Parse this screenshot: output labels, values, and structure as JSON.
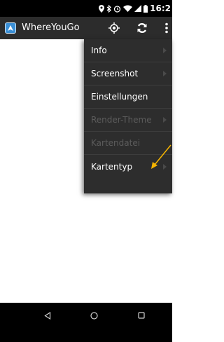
{
  "status_bar": {
    "time": "16:2",
    "icons": [
      "location-icon",
      "bluetooth-icon",
      "alarm-icon",
      "wifi-icon",
      "signal-icon",
      "battery-icon"
    ]
  },
  "app_bar": {
    "title": "WhereYouGo",
    "actions": [
      "gps-target-icon",
      "refresh-icon",
      "overflow-menu-icon"
    ]
  },
  "menu": {
    "items": [
      {
        "label": "Info",
        "enabled": true,
        "has_submenu": true
      },
      {
        "label": "Screenshot",
        "enabled": true,
        "has_submenu": true
      },
      {
        "label": "Einstellungen",
        "enabled": true,
        "has_submenu": false
      },
      {
        "label": "Render-Theme",
        "enabled": false,
        "has_submenu": true
      },
      {
        "label": "Kartendatei",
        "enabled": false,
        "has_submenu": false
      },
      {
        "label": "Kartentyp",
        "enabled": true,
        "has_submenu": true
      }
    ]
  },
  "nav_bar": {
    "buttons": [
      "back-icon",
      "home-icon",
      "recents-icon"
    ]
  },
  "colors": {
    "status_bar": "#000000",
    "app_bar": "#2c2c2c",
    "menu_background": "#2d2d2d",
    "menu_text": "#ffffff",
    "menu_text_disabled": "#5c5c5c",
    "annotation_arrow": "#f5b400",
    "location_marker": "#c9c8f6"
  }
}
